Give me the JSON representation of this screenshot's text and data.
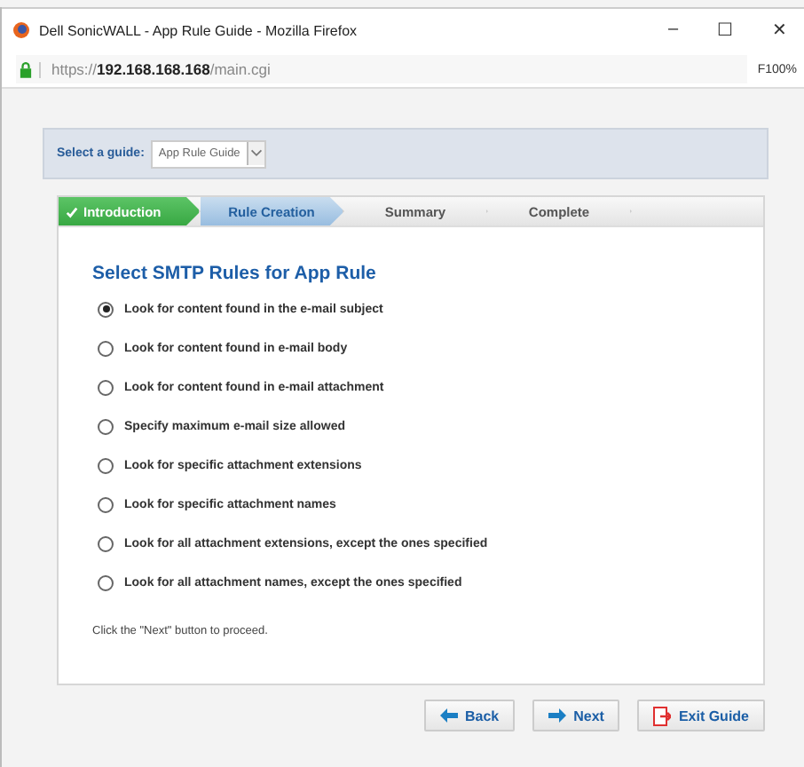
{
  "window": {
    "title": "Dell SonicWALL - App Rule Guide - Mozilla Firefox",
    "controls": [
      "–",
      "☐",
      "✕"
    ]
  },
  "address_bar": {
    "url": "https://**192.168.168.168**/main.cgi",
    "zoom": "F100%"
  },
  "guide_select": {
    "label": "Select a guide:",
    "value": "App Rule Guide"
  },
  "steps": [
    {
      "label": "Introduction",
      "completed": true,
      "selected": false
    },
    {
      "label": "Rule Creation",
      "completed": false,
      "selected": true
    },
    {
      "label": "Summary",
      "completed": false,
      "selected": false
    },
    {
      "label": "Complete",
      "completed": false,
      "selected": false
    }
  ],
  "heading": "Select SMTP Rules for App Rule",
  "options": [
    {
      "label": "Look for content found in the e-mail subject",
      "selected": true
    },
    {
      "label": "Look for content found in e-mail body",
      "selected": false
    },
    {
      "label": "Look for content found in e-mail attachment",
      "selected": false
    },
    {
      "label": "Specify maximum e-mail size allowed",
      "selected": false
    },
    {
      "label": "Look for specific attachment extensions",
      "selected": false
    },
    {
      "label": "Look for specific attachment names",
      "selected": false
    },
    {
      "label": "Look for all attachment extensions, except the ones specified",
      "selected": false
    },
    {
      "label": "Look for all attachment names, except the ones specified",
      "selected": false
    }
  ],
  "hint": "Click the \"Next\" button to proceed.",
  "buttons": [
    {
      "label": "Back",
      "kind": "back"
    },
    {
      "label": "Next",
      "kind": "next"
    },
    {
      "label": "Exit Guide",
      "kind": "exit"
    }
  ]
}
